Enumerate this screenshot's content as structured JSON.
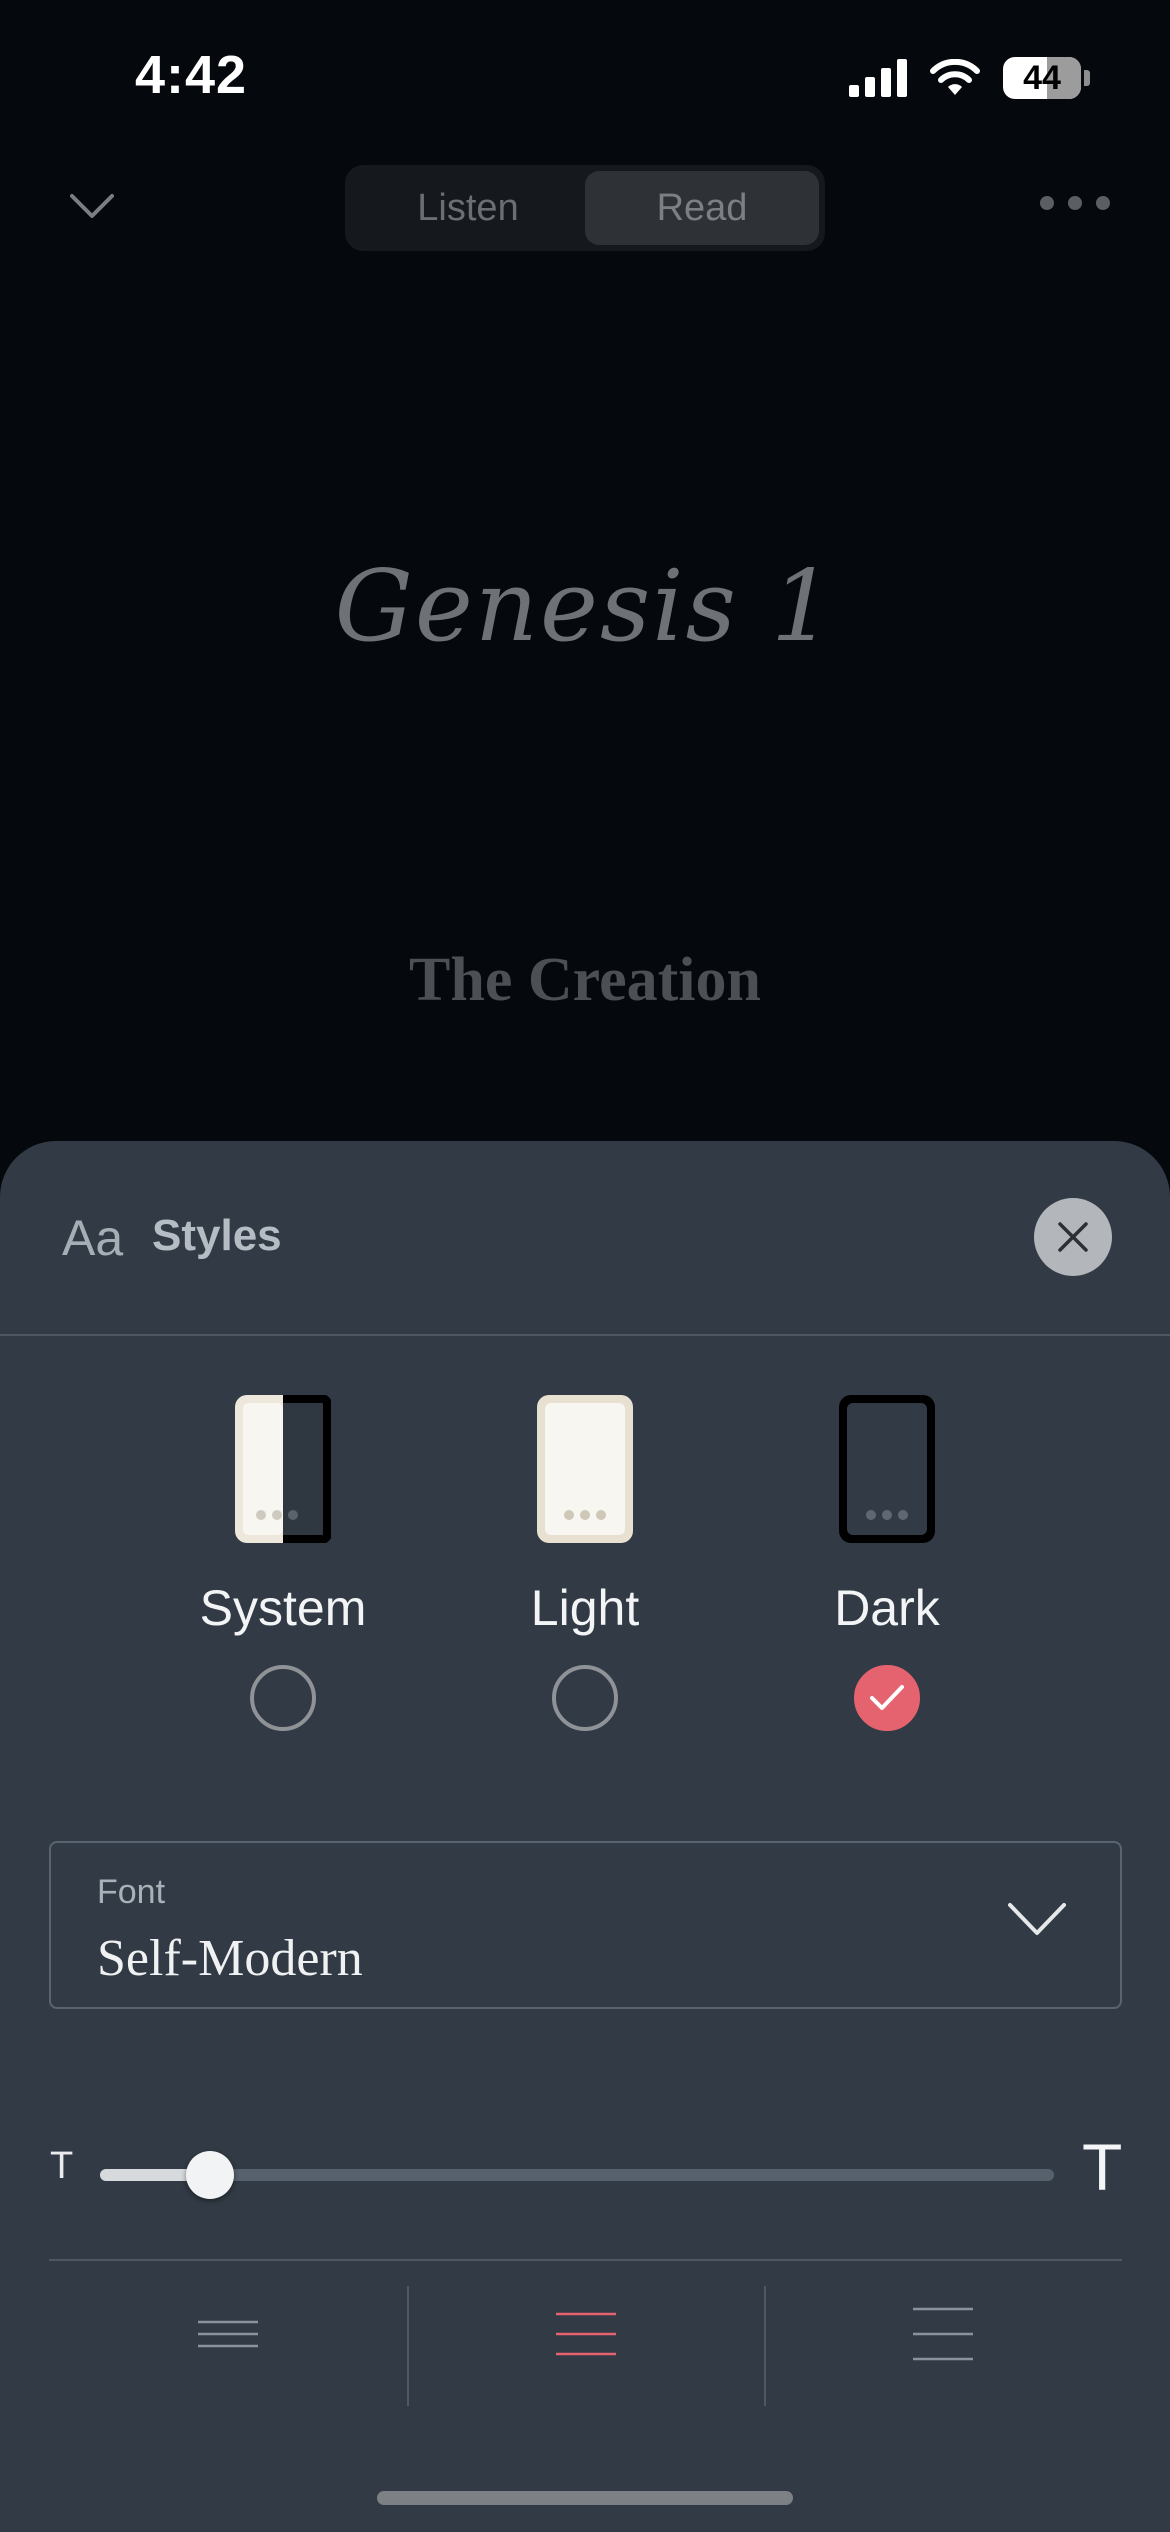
{
  "status_bar": {
    "time": "4:42",
    "battery": "44",
    "icons": [
      "cellular-signal-icon",
      "wifi-icon",
      "battery-icon"
    ]
  },
  "nav": {
    "collapse_icon": "chevron-down-icon",
    "tabs": [
      {
        "label": "Listen",
        "active": false
      },
      {
        "label": "Read",
        "active": true
      }
    ],
    "more_icon": "ellipsis-icon"
  },
  "content": {
    "chapter_title": "Genesis 1",
    "section_heading": "The Creation"
  },
  "styles_sheet": {
    "icon_text": "Aa",
    "title": "Styles",
    "close_icon": "close-icon",
    "themes": [
      {
        "label": "System",
        "selected": false
      },
      {
        "label": "Light",
        "selected": false
      },
      {
        "label": "Dark",
        "selected": true
      }
    ],
    "font": {
      "label": "Font",
      "value": "Self-Modern"
    },
    "text_size": {
      "small_label": "T",
      "large_label": "T",
      "level": 0.115
    },
    "alignment": {
      "options": [
        "align-left-icon",
        "align-center-icon",
        "align-right-icon"
      ],
      "selected": "align-center-icon"
    },
    "accent_color": "#e5636f"
  }
}
